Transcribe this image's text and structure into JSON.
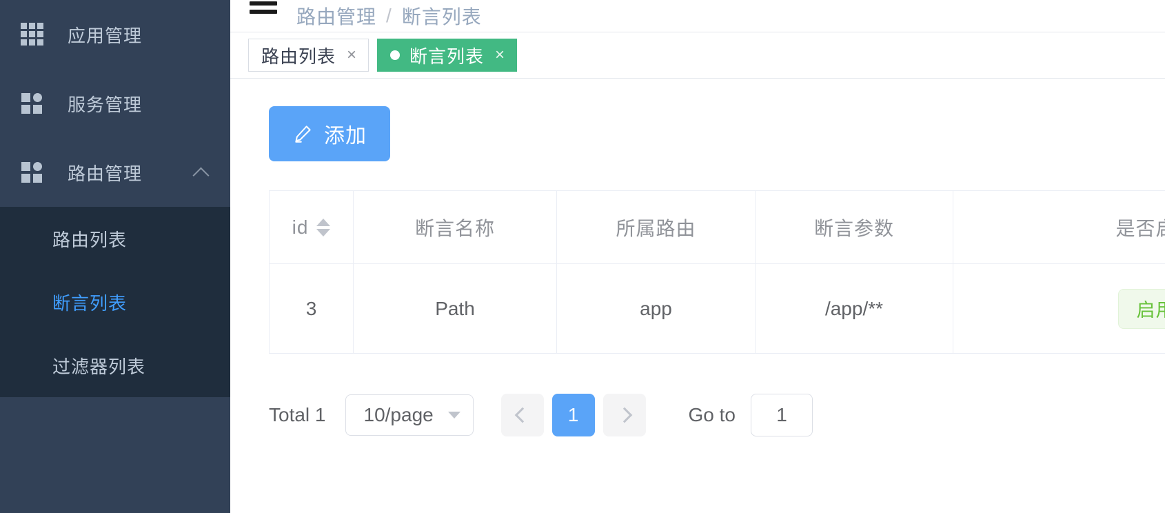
{
  "sidebar": {
    "items": [
      {
        "label": "应用管理",
        "icon": "grid-icon",
        "expandable": false
      },
      {
        "label": "服务管理",
        "icon": "components-icon",
        "expandable": false
      },
      {
        "label": "路由管理",
        "icon": "components-icon",
        "expandable": true,
        "arrow": "chevron-up-icon"
      }
    ],
    "submenu": [
      {
        "label": "路由列表",
        "active": false
      },
      {
        "label": "断言列表",
        "active": true
      },
      {
        "label": "过滤器列表",
        "active": false
      }
    ]
  },
  "topbar": {
    "menu_icon": "hamburger-icon",
    "breadcrumb": {
      "parent": "路由管理",
      "separator": "/",
      "current": "断言列表"
    }
  },
  "tabs": [
    {
      "label": "路由列表",
      "close": "×",
      "active": false
    },
    {
      "label": "断言列表",
      "close": "×",
      "active": true
    }
  ],
  "toolbar": {
    "add_label": "添加",
    "add_icon": "pencil-icon"
  },
  "table": {
    "columns": [
      {
        "label": "id",
        "sortable": true
      },
      {
        "label": "断言名称",
        "sortable": false
      },
      {
        "label": "所属路由",
        "sortable": false
      },
      {
        "label": "断言参数",
        "sortable": false
      },
      {
        "label": "是否启用",
        "sortable": false
      }
    ],
    "rows": [
      {
        "id": "3",
        "name": "Path",
        "route": "app",
        "params": "/app/**",
        "enabled": "启用"
      }
    ]
  },
  "pagination": {
    "total_label": "Total 1",
    "page_size": "10/page",
    "prev_icon": "chevron-left-icon",
    "next_icon": "chevron-right-icon",
    "pages": [
      "1"
    ],
    "current_page": "1",
    "jump_label": "Go to",
    "jump_value": "1"
  },
  "colors": {
    "sidebar_bg": "#324157",
    "submenu_bg": "#1f2d3d",
    "active_menu": "#409eff",
    "tab_active": "#42b983",
    "primary": "#5aa4f8",
    "badge_green": "#67c23a"
  }
}
